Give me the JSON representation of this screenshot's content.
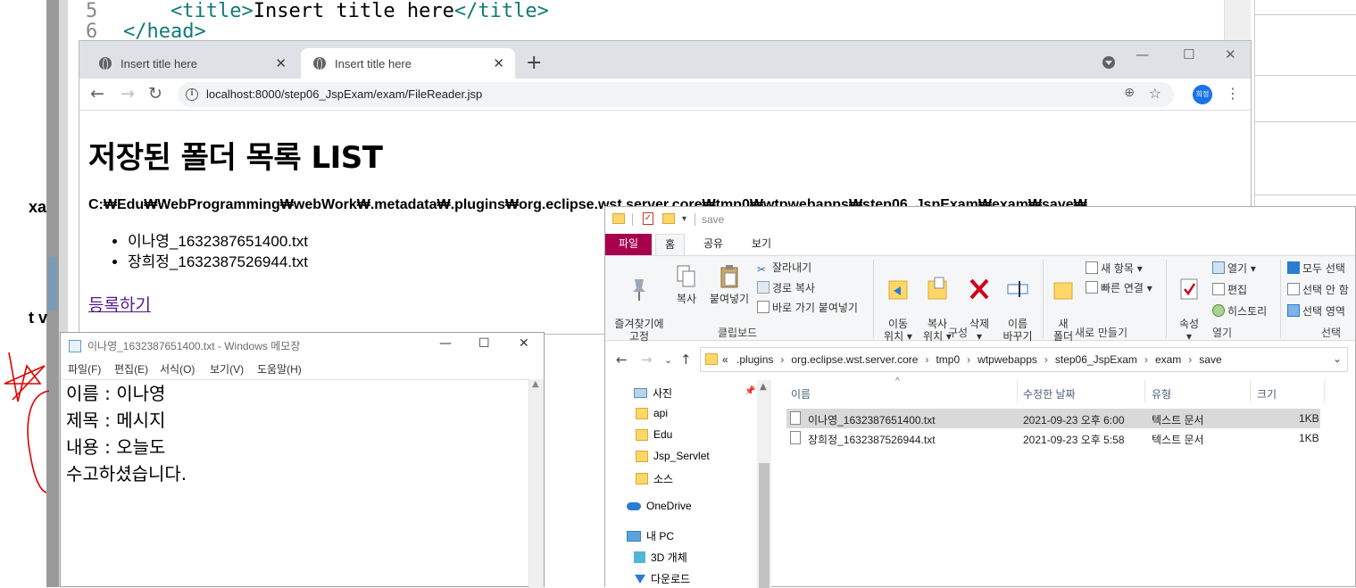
{
  "editor": {
    "line5_num": "5",
    "line5_open": "<title>",
    "line5_text": "Insert title here",
    "line5_close": "</title>",
    "line6_num": "6",
    "line6_text": "</head>"
  },
  "left_fragments": {
    "a": "xa",
    "b": "t v"
  },
  "browser": {
    "tabs": [
      {
        "title": "Insert title here"
      },
      {
        "title": "Insert title here"
      }
    ],
    "new_tab": "+",
    "close_glyph": "✕",
    "minimize": "—",
    "maximize": "☐",
    "close_window": "✕",
    "url": "localhost:8000/step06_JspExam/exam/FileReader.jsp",
    "profile_initials": "희정",
    "page": {
      "heading": "저장된 폴더 목록 LIST",
      "path": "C:₩Edu₩WebProgramming₩webWork₩.metadata₩.plugins₩org.eclipse.wst.server.core₩tmp0₩wtpwebapps₩step06_JspExam₩exam₩save₩",
      "files": [
        "이나영_1632387651400.txt",
        "장희정_1632387526944.txt"
      ],
      "register_link": "등록하기"
    }
  },
  "notepad": {
    "title": "이나영_1632387651400.txt - Windows 메모장",
    "menu": [
      "파일(F)",
      "편집(E)",
      "서식(O)",
      "보기(V)",
      "도움말(H)"
    ],
    "lines": [
      "이름 : 이나영",
      "제목 : 메시지",
      "내용 : 오늘도",
      "수고하셨습니다."
    ]
  },
  "explorer": {
    "title": "save",
    "ribbon_tabs": [
      "파일",
      "홈",
      "공유",
      "보기"
    ],
    "ribbon": {
      "pin": "즐겨찾기에\n고정",
      "copy": "복사",
      "paste": "붙여넣기",
      "cut": "잘라내기",
      "copy_path": "경로 복사",
      "paste_shortcut": "바로 가기 붙여넣기",
      "clipboard_group": "클립보드",
      "move_to": "이동\n위치 ▾",
      "copy_to": "복사\n위치 ▾",
      "delete": "삭제\n▾",
      "rename": "이름\n바꾸기",
      "organize_group": "구성",
      "new_folder": "새\n폴더",
      "new_item": "새 항목 ▾",
      "easy_access": "빠른 연결 ▾",
      "new_group": "새로 만들기",
      "properties": "속성\n▾",
      "open": "열기 ▾",
      "edit": "편집",
      "history": "히스토리",
      "open_group": "열기",
      "select_all": "모두 선택",
      "select_none": "선택 안 함",
      "invert_selection": "선택 영역",
      "select_group": "선택"
    },
    "breadcrumb": [
      ".plugins",
      "org.eclipse.wst.server.core",
      "tmp0",
      "wtpwebapps",
      "step06_JspExam",
      "exam",
      "save"
    ],
    "breadcrumb_prefix": "«",
    "nav_items": [
      {
        "label": "사진",
        "icon": "pictures-icon"
      },
      {
        "label": "api",
        "icon": "folder-icon"
      },
      {
        "label": "Edu",
        "icon": "folder-icon"
      },
      {
        "label": "Jsp_Servlet",
        "icon": "folder-icon"
      },
      {
        "label": "소스",
        "icon": "folder-icon"
      },
      {
        "label": "OneDrive",
        "icon": "onedrive-icon"
      },
      {
        "label": "내 PC",
        "icon": "pc-icon"
      },
      {
        "label": "3D 개체",
        "icon": "3d-objects-icon"
      },
      {
        "label": "다운로드",
        "icon": "downloads-icon"
      }
    ],
    "columns": [
      "이름",
      "수정한 날짜",
      "유형",
      "크기"
    ],
    "files": [
      {
        "name": "이나영_1632387651400.txt",
        "modified": "2021-09-23 오후 6:00",
        "type": "텍스트 문서",
        "size": "1KB",
        "selected": true
      },
      {
        "name": "장희정_1632387526944.txt",
        "modified": "2021-09-23 오후 5:58",
        "type": "텍스트 문서",
        "size": "1KB",
        "selected": false
      }
    ]
  }
}
